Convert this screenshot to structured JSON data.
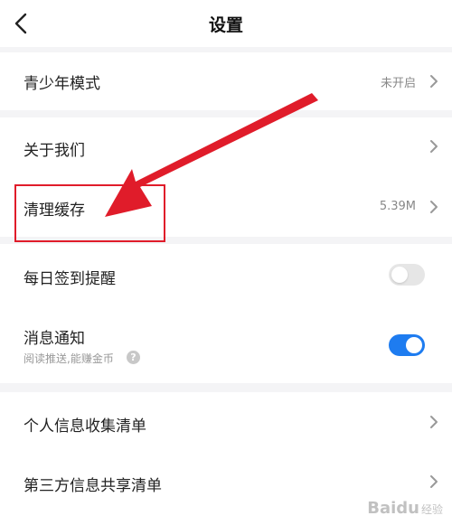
{
  "header": {
    "title": "设置"
  },
  "rows": {
    "youth_mode": {
      "label": "青少年模式",
      "value": "未开启"
    },
    "about": {
      "label": "关于我们"
    },
    "clear_cache": {
      "label": "清理缓存",
      "value": "5.39M"
    },
    "checkin_reminder": {
      "label": "每日签到提醒",
      "toggle": "off"
    },
    "notifications": {
      "label": "消息通知",
      "sub": "阅读推送,能赚金币",
      "help": "?",
      "toggle": "on"
    },
    "personal_info": {
      "label": "个人信息收集清单"
    },
    "third_party": {
      "label": "第三方信息共享清单"
    }
  },
  "colors": {
    "accent": "#1e7cf0",
    "annotation": "#e01c2a",
    "section_gap": "#f4f4f6"
  },
  "watermark": {
    "text": "Baidu",
    "sub": "经验"
  }
}
